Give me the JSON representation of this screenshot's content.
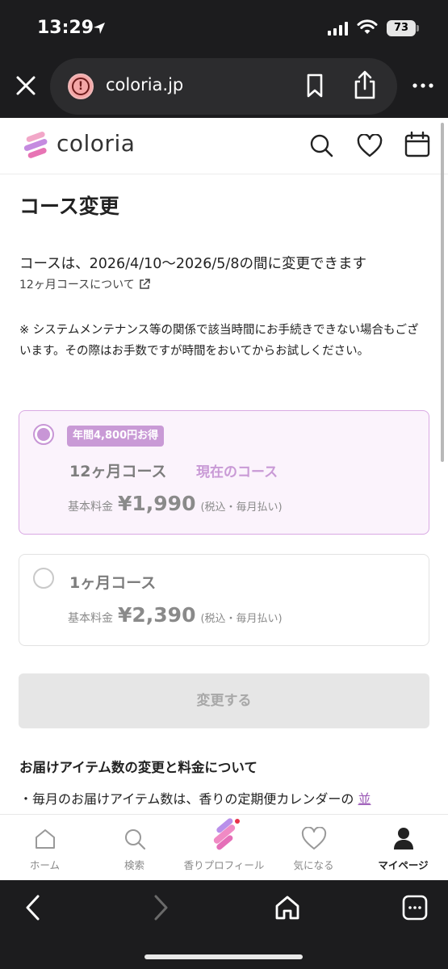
{
  "status_bar": {
    "time": "13:29",
    "battery": "73"
  },
  "browser": {
    "url": "coloria.jp"
  },
  "site": {
    "logo_text": "coloria"
  },
  "page": {
    "title": "コース変更",
    "period_text": "コースは、2026/4/10〜2026/5/8の間に変更できます",
    "course_link": "12ヶ月コースについて",
    "notice": "※ システムメンテナンス等の関係で該当時間にお手続きできない場合もございます。その際はお手数ですが時間をおいてからお試しください。"
  },
  "courses": [
    {
      "badge": "年間4,800円お得",
      "name": "12ヶ月コース",
      "current_label": "現在のコース",
      "price_label": "基本料金",
      "price": "¥1,990",
      "price_note": "(税込・毎月払い)",
      "selected": true
    },
    {
      "name": "1ヶ月コース",
      "price_label": "基本料金",
      "price": "¥2,390",
      "price_note": "(税込・毎月払い)",
      "selected": false
    }
  ],
  "change_button": "変更する",
  "section": {
    "title": "お届けアイテム数の変更と料金について",
    "body": "・毎月のお届けアイテム数は、香りの定期便カレンダーの",
    "body_link": "並"
  },
  "tabs": [
    {
      "label": "ホーム",
      "icon": "home-icon"
    },
    {
      "label": "検索",
      "icon": "search-icon"
    },
    {
      "label": "香りプロフィール",
      "icon": "coloria-logo-icon"
    },
    {
      "label": "気になる",
      "icon": "heart-icon"
    },
    {
      "label": "マイページ",
      "icon": "person-icon",
      "active": true
    }
  ],
  "colors": {
    "accent": "#c99ad6",
    "selected_card_bg": "#fbf3fc",
    "browser_chrome": "#1c1c1e"
  }
}
